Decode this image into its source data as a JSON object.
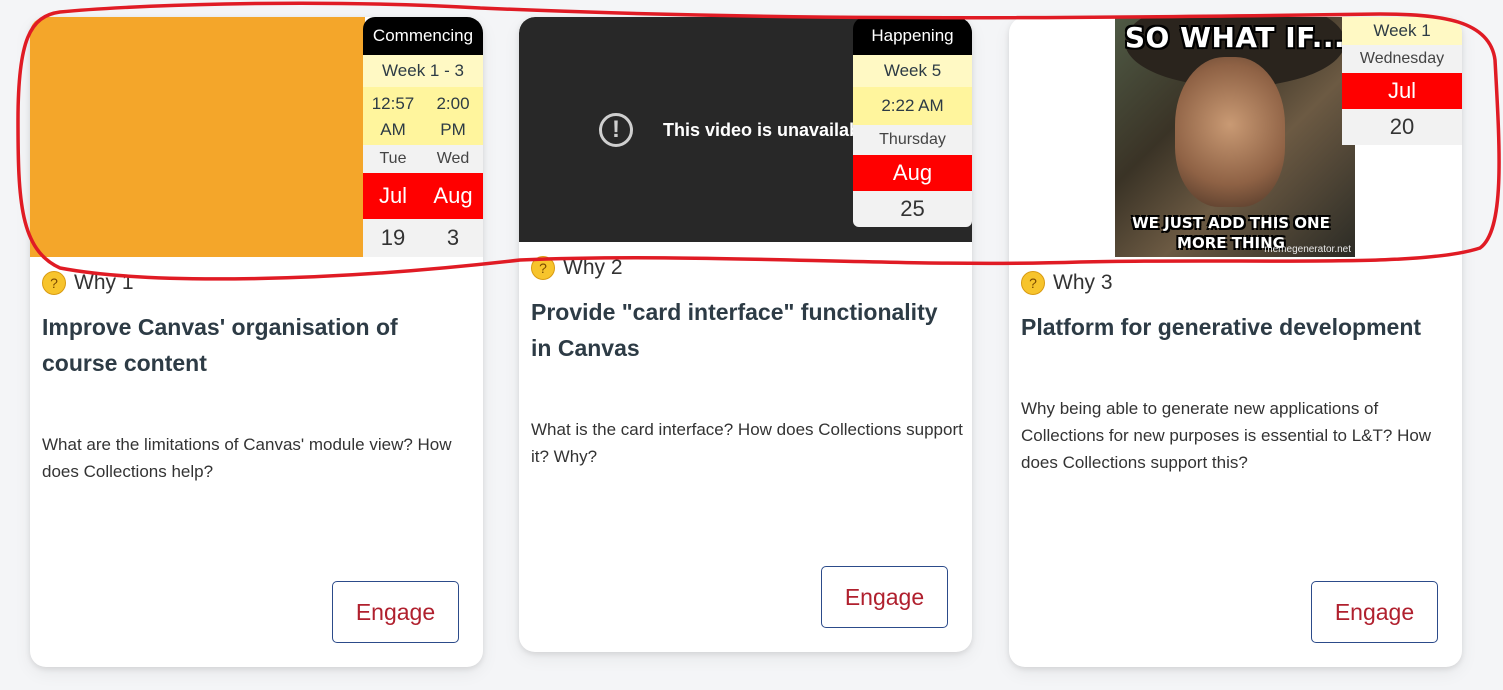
{
  "cards": [
    {
      "calendar": {
        "header": "Commencing",
        "week": "Week 1 - 3",
        "times": [
          "12:57\nAM",
          "2:00\nPM"
        ],
        "days": [
          "Tue",
          "Wed"
        ],
        "months": [
          "Jul",
          "Aug"
        ],
        "dates": [
          "19",
          "3"
        ]
      },
      "why_label": "Why 1",
      "title": "Improve Canvas' organisation of course content",
      "description": "What are the limitations of Canvas' module view? How does Collections help?",
      "button_label": "Engage"
    },
    {
      "video_message": "This video is unavailable",
      "calendar": {
        "header": "Happening",
        "week": "Week 5",
        "time": "2:22 AM",
        "day": "Thursday",
        "month": "Aug",
        "date": "25"
      },
      "why_label": "Why 2",
      "title": "Provide \"card interface\" functionality in Canvas",
      "description": "What is the card interface? How does Collections support it? Why?",
      "button_label": "Engage"
    },
    {
      "meme": {
        "top_text": "SO WHAT IF...",
        "bottom_text": "WE JUST ADD THIS ONE MORE THING",
        "watermark": "memegenerator.net"
      },
      "calendar": {
        "week": "Week 1",
        "day": "Wednesday",
        "month": "Jul",
        "date": "20"
      },
      "why_label": "Why 3",
      "title": "Platform for generative development",
      "description": "Why being able to generate new applications of Collections for new purposes is essential to L&T? How does Collections support this?",
      "button_label": "Engage"
    }
  ],
  "colors": {
    "accent_red": "#ff0000",
    "button_text": "#b0202e",
    "button_border": "#2c4b8a",
    "annotation": "#e01b24"
  }
}
